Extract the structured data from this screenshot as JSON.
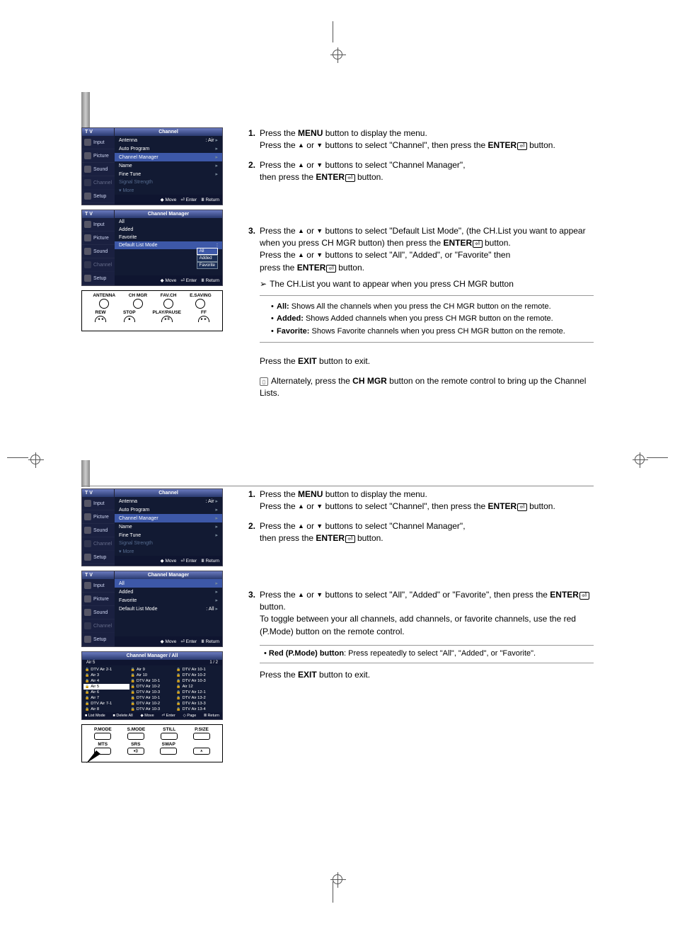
{
  "osd_common": {
    "tv_label": "T V",
    "side": {
      "input": "Input",
      "picture": "Picture",
      "sound": "Sound",
      "channel": "Channel",
      "setup": "Setup"
    },
    "footer": {
      "move": "Move",
      "enter": "Enter",
      "return": "Return"
    }
  },
  "osd1": {
    "title": "Channel",
    "rows": {
      "antenna": "Antenna",
      "antenna_val": ": Air",
      "auto_program": "Auto Program",
      "channel_manager": "Channel Manager",
      "name": "Name",
      "fine_tune": "Fine Tune",
      "signal_strength": "Signal Strength",
      "more": "More"
    }
  },
  "osd2": {
    "title": "Channel Manager",
    "rows": {
      "all": "All",
      "added": "Added",
      "favorite": "Favorite",
      "default_list_mode": "Default List Mode",
      "sep": ":"
    },
    "options": {
      "all": "All",
      "added": "Added",
      "favorite": "Favorite"
    }
  },
  "remote1": {
    "row1": {
      "antenna": "ANTENNA",
      "chmgr": "CH MGR",
      "favch": "FAV.CH",
      "esaving": "E.SAVING"
    },
    "row2": {
      "rew": "REW",
      "stop": "STOP",
      "playpause": "PLAY/PAUSE",
      "ff": "FF"
    },
    "sym": {
      "rew": "◄◄",
      "stop": "■",
      "play": "►II",
      "ff": "►►"
    }
  },
  "osd3": {
    "title": "Channel Manager",
    "rows": {
      "all": "All",
      "added": "Added",
      "favorite": "Favorite",
      "default_list_mode": "Default List Mode",
      "dlm_val": ": All"
    }
  },
  "chlist": {
    "title": "Channel Manager / All",
    "sub_left": "Air 5",
    "sub_right": "1 / 2",
    "cells": [
      "DTV Air 2-1",
      "Air 9",
      "DTV Air 10-1",
      "Air 3",
      "Air 10",
      "DTV Air 10-2",
      "Air 4",
      "DTV Air 10-1",
      "DTV Air 10-3",
      "Air 5",
      "DTV Air 10-2",
      "Air 12",
      "Air 6",
      "DTV Air 10-3",
      "DTV Air 12-1",
      "Air 7",
      "DTV Air 10-1",
      "DTV Air 13-2",
      "DTV Air 7-1",
      "DTV Air 10-2",
      "DTV Air 13-3",
      "Air 8",
      "DTV Air 10-3",
      "DTV Air 13-4"
    ],
    "hl_index": 9,
    "foot": {
      "list_mode": "List Mode",
      "delete_all": "Delete All",
      "move": "Move",
      "enter": "Enter",
      "page": "Page",
      "return": "Return"
    }
  },
  "remote2": {
    "row1": {
      "pmode": "P.MODE",
      "smode": "S.MODE",
      "still": "STILL",
      "psize": "P.SIZE"
    },
    "row2": {
      "mts": "MTS",
      "srs": "SRS",
      "swap": "SWAP",
      "up": "∧"
    }
  },
  "steps_top": {
    "s1_a": "Press the ",
    "s1_b": " button to display the menu.",
    "s1_c": "Press the ",
    "s1_d": " buttons to select \"Channel\", then press the ",
    "s1_e": " button.",
    "s1_menu": "MENU",
    "s1_or": " or ",
    "s1_enter": "ENTER",
    "s2_a": "Press the ",
    "s2_b": " buttons to select \"Channel Manager\",",
    "s2_c": "then press the ",
    "s2_d": " button.",
    "s3_a": "Press the ",
    "s3_b": " buttons to select \"Default List Mode\", (the CH.List you want to appear when you press CH MGR button) then press the ",
    "s3_c": " button.",
    "s3_d": "Press the ",
    "s3_e": " buttons to select \"All\", \"Added\", or \"Favorite\" then",
    "s3_f": "press the ",
    "s3_g": " button.",
    "note_lead": "The CH.List you want to appear when you press CH MGR button",
    "bul_all_b": "All:",
    "bul_all": " Shows All the channels when you press the CH MGR button on the remote.",
    "bul_added_b": "Added:",
    "bul_added": " Shows Added channels when you press CH MGR button on the remote.",
    "bul_fav_b": "Favorite:",
    "bul_fav": " Shows Favorite channels when you press CH MGR button on the remote.",
    "exit_a": "Press the ",
    "exit_b": "EXIT",
    "exit_c": " button to exit.",
    "alt_a": "Alternately, press the ",
    "alt_b": "CH MGR",
    "alt_c": " button on the remote control to bring up the Channel Lists."
  },
  "steps_bottom": {
    "s3_a": "Press the ",
    "s3_b": " buttons to select \"All\", \"Added\" or \"Favorite\", then press the ",
    "s3_c": " button.",
    "s3_d": "To toggle between your all channels, add channels, or favorite channels, use the red (P.Mode) button on the remote control.",
    "note_b": "Red (P.Mode) button",
    "note_t": ": Press repeatedly to select \"All\", \"Added\", or \"Favorite\".",
    "exit_a": "Press the ",
    "exit_b": "EXIT",
    "exit_c": " button to exit."
  }
}
